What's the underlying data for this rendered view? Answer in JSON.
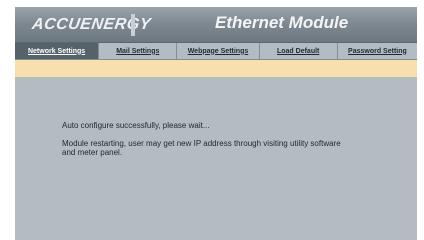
{
  "header": {
    "logo_text": "ACCUENERGY",
    "module_title": "Ethernet Module",
    "colors": {
      "header_bg": "#7f8991",
      "content_bg": "#b3bcc3",
      "notice_bar": "#f8dfae",
      "active_tab": "#56626a"
    }
  },
  "tabs": [
    {
      "label": "Network Settings",
      "active": true
    },
    {
      "label": "Mail Settings",
      "active": false
    },
    {
      "label": "Webpage Settings",
      "active": false
    },
    {
      "label": "Load Default",
      "active": false
    },
    {
      "label": "Password Setting",
      "active": false
    }
  ],
  "notice": {
    "text": ""
  },
  "messages": {
    "status": "Auto configure successfully, please wait...",
    "restart": "Module restarting, user may get new IP address through visiting utility software and meter panel."
  }
}
